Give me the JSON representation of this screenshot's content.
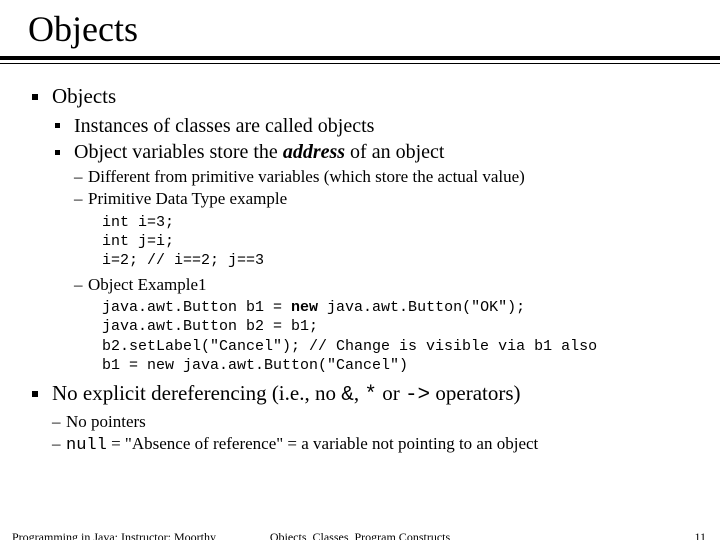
{
  "title": "Objects",
  "b1": {
    "heading": "Objects",
    "s1": "Instances of classes are called objects",
    "s2_pre": "Object variables store the ",
    "s2_em": "address",
    "s2_post": " of an object",
    "d1": "Different from primitive variables (which store the actual value)",
    "d2": "Primitive Data Type example",
    "code1": "int i=3;\nint j=i;\ni=2; // i==2; j==3",
    "d3": "Object Example1",
    "code2_l1_a": "java.awt.Button b1 = ",
    "code2_l1_b": "new",
    "code2_l1_c": " java.awt.Button(\"OK\");",
    "code2_l2": "java.awt.Button b2 = b1;",
    "code2_l3": "b2.setLabel(\"Cancel\"); // Change is visible via b1 also",
    "code2_l4": "b1 = new java.awt.Button(\"Cancel\")"
  },
  "b2": {
    "text_pre": "No explicit dereferencing (i.e., no ",
    "sym1": "&",
    "mid1": ", ",
    "sym2": "*",
    "mid2": " or ",
    "sym3": "->",
    "text_post": " operators)",
    "d1": "No pointers",
    "d2_code": "null",
    "d2_rest": " = \"Absence of reference\" = a variable not pointing to an object"
  },
  "footer": {
    "left": "Programming in Java; Instructor: Moorthy",
    "center": "Objects, Classes, Program Constructs",
    "right": "11"
  }
}
